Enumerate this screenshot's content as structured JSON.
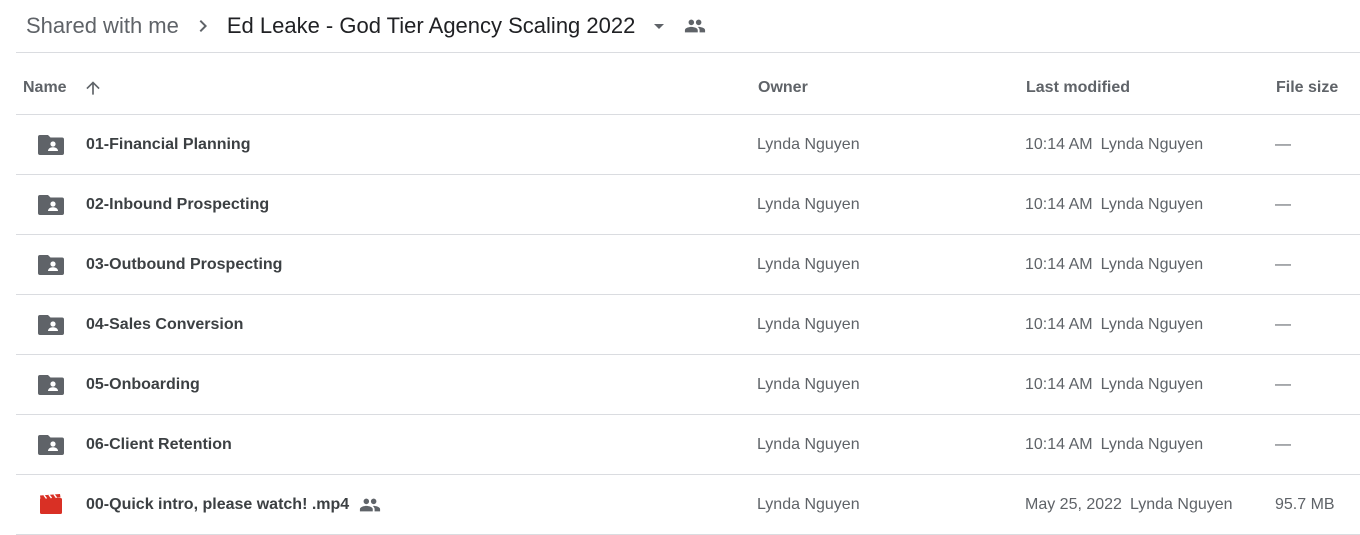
{
  "breadcrumb": {
    "parent": "Shared with me",
    "current": "Ed Leake - God Tier Agency Scaling 2022",
    "separator_icon": "chevron-right-icon",
    "dropdown_icon": "caret-down-icon",
    "shared_icon": "people-icon"
  },
  "columns": {
    "name": "Name",
    "owner": "Owner",
    "last_modified": "Last modified",
    "file_size": "File size",
    "sort_icon": "arrow-up-icon"
  },
  "files": [
    {
      "name": "01-Financial Planning",
      "type": "shared-folder",
      "owner": "Lynda Nguyen",
      "modified_time": "10:14 AM",
      "modified_by": "Lynda Nguyen",
      "size": "—"
    },
    {
      "name": "02-Inbound Prospecting",
      "type": "shared-folder",
      "owner": "Lynda Nguyen",
      "modified_time": "10:14 AM",
      "modified_by": "Lynda Nguyen",
      "size": "—"
    },
    {
      "name": "03-Outbound Prospecting",
      "type": "shared-folder",
      "owner": "Lynda Nguyen",
      "modified_time": "10:14 AM",
      "modified_by": "Lynda Nguyen",
      "size": "—"
    },
    {
      "name": "04-Sales Conversion",
      "type": "shared-folder",
      "owner": "Lynda Nguyen",
      "modified_time": "10:14 AM",
      "modified_by": "Lynda Nguyen",
      "size": "—"
    },
    {
      "name": "05-Onboarding",
      "type": "shared-folder",
      "owner": "Lynda Nguyen",
      "modified_time": "10:14 AM",
      "modified_by": "Lynda Nguyen",
      "size": "—"
    },
    {
      "name": "06-Client Retention",
      "type": "shared-folder",
      "owner": "Lynda Nguyen",
      "modified_time": "10:14 AM",
      "modified_by": "Lynda Nguyen",
      "size": "—"
    },
    {
      "name": "00-Quick intro, please watch! .mp4",
      "type": "video",
      "owner": "Lynda Nguyen",
      "modified_time": "May 25, 2022",
      "modified_by": "Lynda Nguyen",
      "size": "95.7 MB",
      "shared": true
    }
  ],
  "colors": {
    "folder_icon": "#5f6368",
    "video_icon": "#d93025",
    "divider": "#dadce0"
  }
}
